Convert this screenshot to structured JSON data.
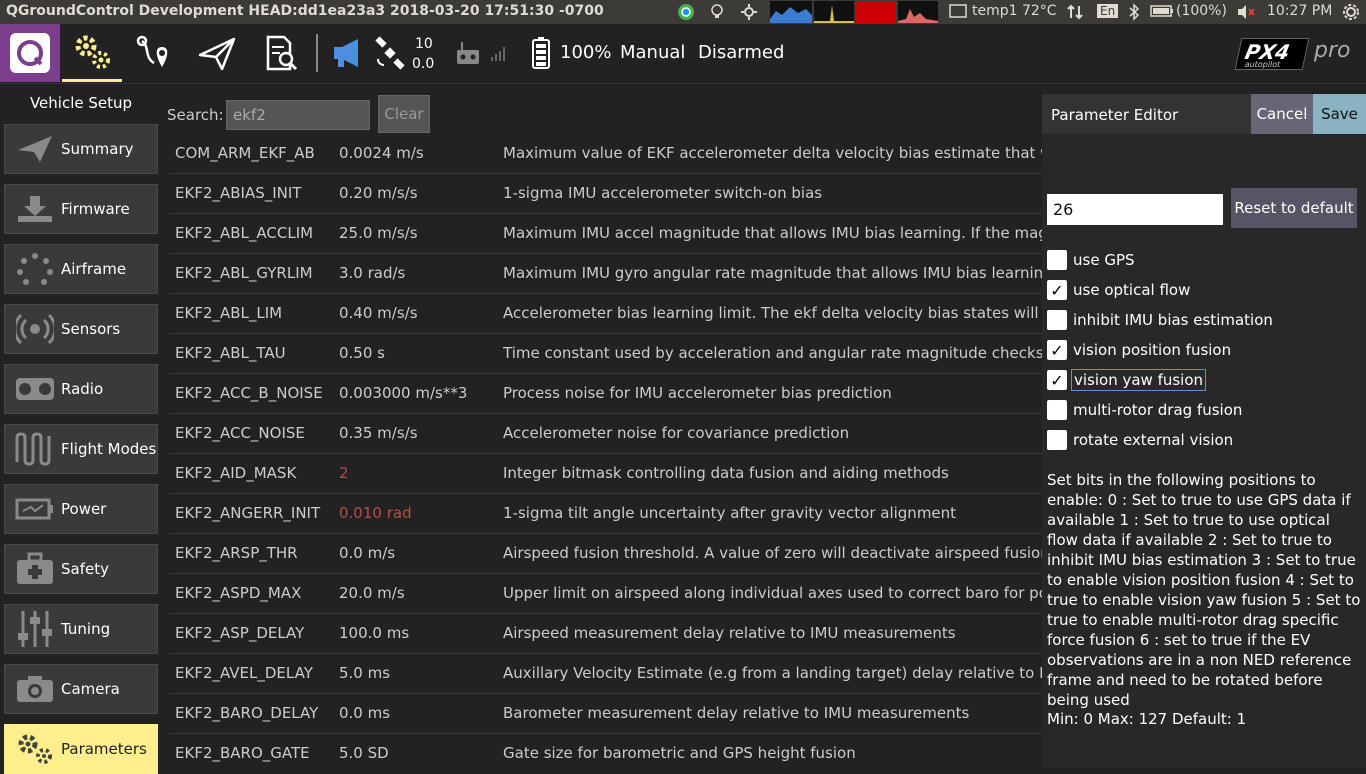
{
  "os_bar": {
    "title": "QGroundControl Development HEAD:dd1ea23a3 2018-03-20 17:51:30 -0700",
    "temp": "temp1 72°C",
    "lang": "En",
    "battery": "(100%)",
    "clock": "10:27 PM"
  },
  "toolbar": {
    "gps_count": "10",
    "gps_hdop": "0.0",
    "battery_pct": "100%",
    "flight_mode": "Manual",
    "arm_state": "Disarmed",
    "brand_logo": "PX4",
    "brand_sub": "autopilot",
    "brand_pro": "pro"
  },
  "sidebar": {
    "title": "Vehicle Setup",
    "items": [
      {
        "label": "Summary",
        "icon": "paper-plane-icon"
      },
      {
        "label": "Firmware",
        "icon": "download-icon"
      },
      {
        "label": "Airframe",
        "icon": "airframe-icon"
      },
      {
        "label": "Sensors",
        "icon": "sensors-icon"
      },
      {
        "label": "Radio",
        "icon": "radio-icon"
      },
      {
        "label": "Flight Modes",
        "icon": "wave-icon"
      },
      {
        "label": "Power",
        "icon": "battery-icon"
      },
      {
        "label": "Safety",
        "icon": "medkit-icon"
      },
      {
        "label": "Tuning",
        "icon": "sliders-icon"
      },
      {
        "label": "Camera",
        "icon": "camera-icon"
      },
      {
        "label": "Parameters",
        "icon": "gears-icon"
      }
    ]
  },
  "search": {
    "label": "Search:",
    "value": "ekf2",
    "clear_label": "Clear"
  },
  "params": [
    {
      "name": "COM_ARM_EKF_AB",
      "value": "0.0024 m/s",
      "desc": "Maximum value of EKF accelerometer delta velocity bias estimate that will allo"
    },
    {
      "name": "EKF2_ABIAS_INIT",
      "value": "0.20 m/s/s",
      "desc": "1-sigma IMU accelerometer switch-on bias"
    },
    {
      "name": "EKF2_ABL_ACCLIM",
      "value": "25.0 m/s/s",
      "desc": "Maximum IMU accel magnitude that allows IMU bias learning. If the magnitud"
    },
    {
      "name": "EKF2_ABL_GYRLIM",
      "value": "3.0 rad/s",
      "desc": "Maximum IMU gyro angular rate magnitude that allows IMU bias learning. If t"
    },
    {
      "name": "EKF2_ABL_LIM",
      "value": "0.40 m/s/s",
      "desc": "Accelerometer bias learning limit. The ekf delta velocity bias states will be limi"
    },
    {
      "name": "EKF2_ABL_TAU",
      "value": "0.50 s",
      "desc": "Time constant used by acceleration and angular rate magnitude checks used"
    },
    {
      "name": "EKF2_ACC_B_NOISE",
      "value": "0.003000 m/s**3",
      "desc": "Process noise for IMU accelerometer bias prediction"
    },
    {
      "name": "EKF2_ACC_NOISE",
      "value": "0.35 m/s/s",
      "desc": "Accelerometer noise for covariance prediction"
    },
    {
      "name": "EKF2_AID_MASK",
      "value": "2",
      "desc": "Integer bitmask controlling data fusion and aiding methods"
    },
    {
      "name": "EKF2_ANGERR_INIT",
      "value": "0.010 rad",
      "desc": "1-sigma tilt angle uncertainty after gravity vector alignment"
    },
    {
      "name": "EKF2_ARSP_THR",
      "value": "0.0 m/s",
      "desc": "Airspeed fusion threshold. A value of zero will deactivate airspeed fusion. Any"
    },
    {
      "name": "EKF2_ASPD_MAX",
      "value": "20.0 m/s",
      "desc": "Upper limit on airspeed along individual axes used to correct baro for position"
    },
    {
      "name": "EKF2_ASP_DELAY",
      "value": "100.0 ms",
      "desc": "Airspeed measurement delay relative to IMU measurements"
    },
    {
      "name": "EKF2_AVEL_DELAY",
      "value": "5.0 ms",
      "desc": "Auxillary Velocity Estimate (e.g from a landing target) delay relative to IMU me"
    },
    {
      "name": "EKF2_BARO_DELAY",
      "value": "0.0 ms",
      "desc": "Barometer measurement delay relative to IMU measurements"
    },
    {
      "name": "EKF2_BARO_GATE",
      "value": "5.0 SD",
      "desc": "Gate size for barometric and GPS height fusion"
    }
  ],
  "editor": {
    "title": "Parameter Editor",
    "cancel_label": "Cancel",
    "save_label": "Save",
    "value": "26",
    "reset_label": "Reset to default",
    "bits": [
      {
        "label": "use GPS",
        "checked": false
      },
      {
        "label": "use optical flow",
        "checked": true
      },
      {
        "label": "inhibit IMU bias estimation",
        "checked": false
      },
      {
        "label": "vision position fusion",
        "checked": true
      },
      {
        "label": "vision yaw fusion",
        "checked": true
      },
      {
        "label": "multi-rotor drag fusion",
        "checked": false
      },
      {
        "label": "rotate external vision",
        "checked": false
      }
    ],
    "help": "Set bits in the following positions to enable: 0 : Set to true to use GPS data if available 1 : Set to true to use optical flow data if available 2 : Set to true to inhibit IMU bias estimation 3 : Set to true to enable vision position fusion 4 : Set to true to enable vision yaw fusion 5 : Set to true to enable multi-rotor drag specific force fusion 6 : set to true if the EV observations are in a non NED reference frame and need to be rotated before being used",
    "range": "Min: 0  Max: 127  Default: 1"
  },
  "colors": {
    "accent": "#ffef8c",
    "modified": "#b54e4a",
    "save": "#8ab2c0"
  }
}
